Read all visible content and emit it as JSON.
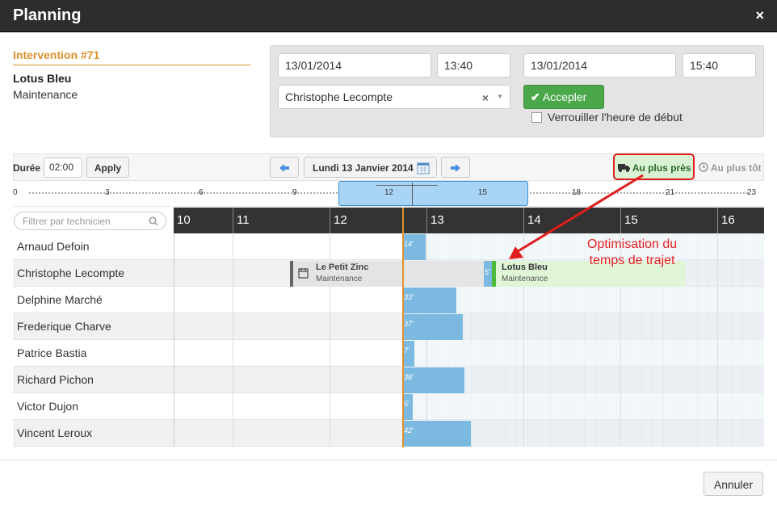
{
  "dialog": {
    "title": "Planning",
    "close_label": "×"
  },
  "intervention": {
    "title": "Intervention #71",
    "client": "Lotus Bleu",
    "type": "Maintenance"
  },
  "form": {
    "start_date": "13/01/2014",
    "start_time": "13:40",
    "end_date": "13/01/2014",
    "end_time": "15:40",
    "technician": "Christophe Lecompte",
    "clear_label": "×",
    "dropdown_arrow": "▼",
    "accept_label": "Accepler",
    "lock_label": "Verrouiller l'heure de début"
  },
  "toolbar": {
    "duration_label": "Durée",
    "duration_value": "02:00",
    "apply_label": "Apply",
    "date_label": "Lundi 13 Janvier 2014",
    "nearest_label": "Au plus près",
    "earliest_label": "Au plus tôt"
  },
  "ruler": {
    "ticks": [
      "0",
      "3",
      "6",
      "9",
      "12",
      "15",
      "18",
      "21",
      "23"
    ]
  },
  "filter": {
    "placeholder": "Filtrer par technicien"
  },
  "hours": [
    "10",
    "11",
    "12",
    "13",
    "14",
    "15",
    "16"
  ],
  "technicians": [
    {
      "name": "Arnaud Defoin",
      "travel": "14'"
    },
    {
      "name": "Christophe Lecompte",
      "travel": "5'"
    },
    {
      "name": "Delphine Marché",
      "travel": "33'"
    },
    {
      "name": "Frederique Charve",
      "travel": "37'"
    },
    {
      "name": "Patrice Bastia",
      "travel": "7'"
    },
    {
      "name": "Richard Pichon",
      "travel": "38'"
    },
    {
      "name": "Victor Dujon",
      "travel": "5'"
    },
    {
      "name": "Vincent Leroux",
      "travel": "42'"
    }
  ],
  "events": {
    "existing": {
      "title": "Le Petit Zinc",
      "subtitle": "Maintenance"
    },
    "proposed": {
      "title": "Lotus Bleu",
      "subtitle": "Maintenance"
    }
  },
  "annotation": {
    "line1": "Optimisation du",
    "line2": "temps de trajet"
  },
  "footer": {
    "cancel_label": "Annuler"
  },
  "colors": {
    "accent_orange": "#e0902c",
    "accept_green": "#4aa84a",
    "annotation_red": "#e21c1c",
    "travel_blue": "#7cb9e0"
  }
}
